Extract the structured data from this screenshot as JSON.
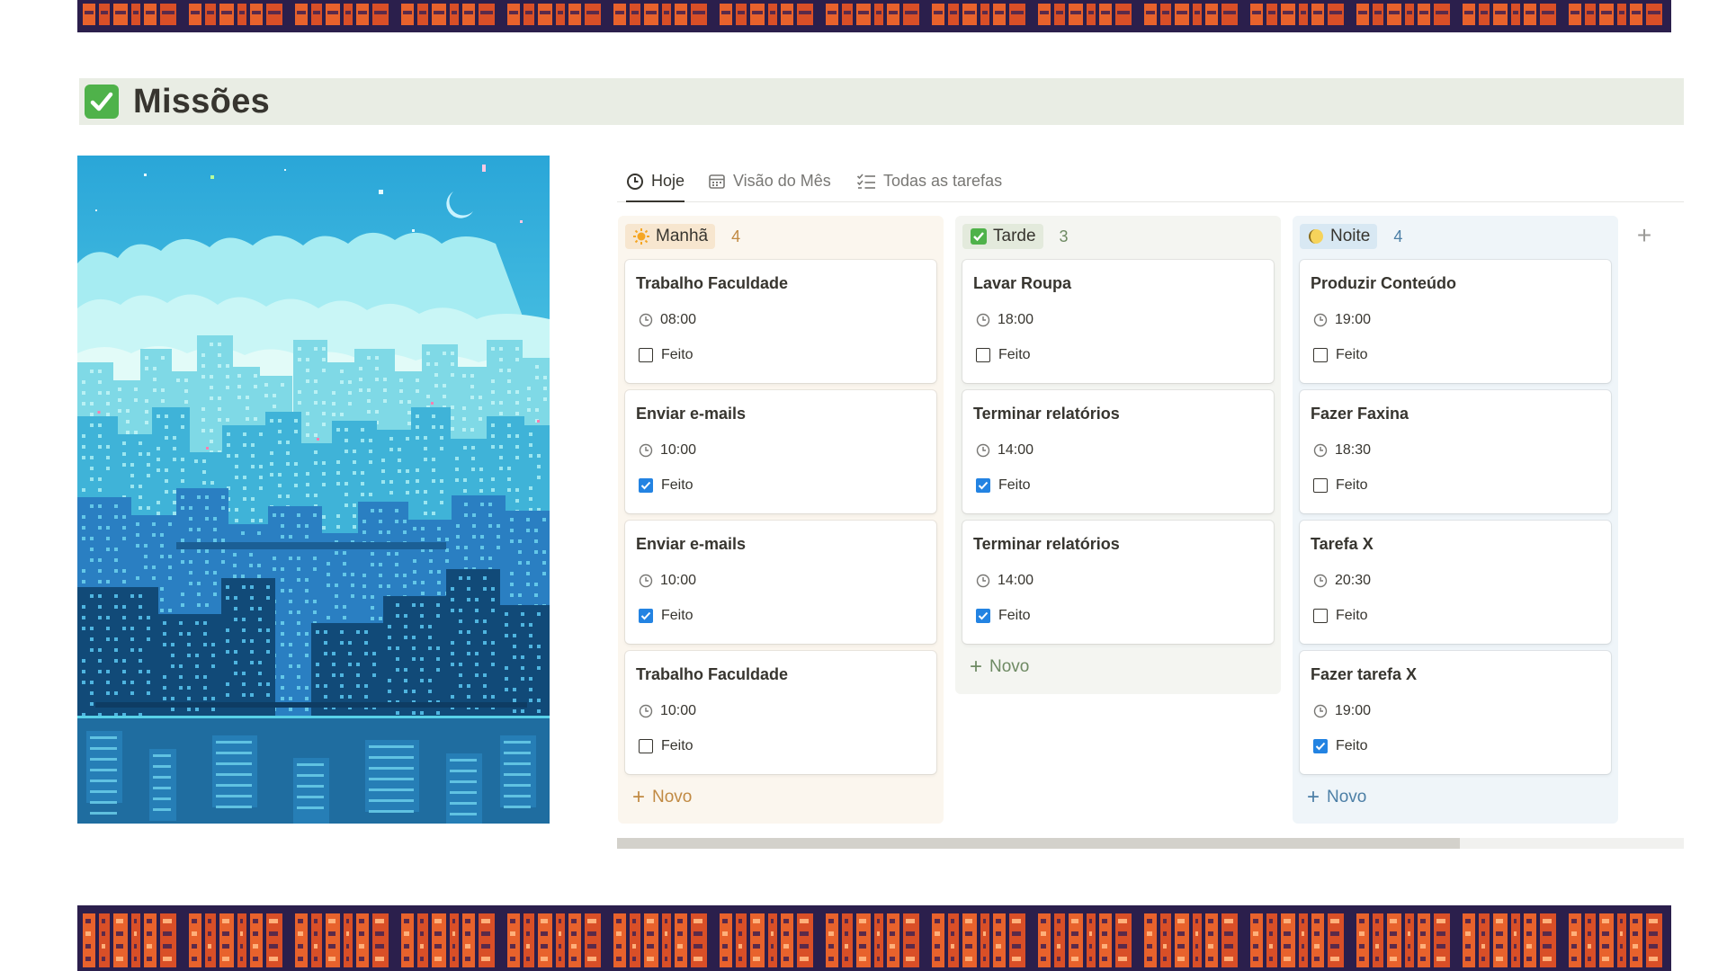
{
  "page": {
    "title": "Missões",
    "title_icon": "check-mark-button-emoji"
  },
  "tabs": [
    {
      "label": "Hoje",
      "icon": "clock-icon",
      "active": true
    },
    {
      "label": "Visão do Mês",
      "icon": "calendar-icon",
      "active": false
    },
    {
      "label": "Todas as tarefas",
      "icon": "checklist-icon",
      "active": false
    }
  ],
  "board": {
    "columns": [
      {
        "name": "Manhã",
        "icon": "sun-icon",
        "count": "4",
        "colors": {
          "bg": "#fbf6ee",
          "pill": "#f7e6cf",
          "count": "#c18a43",
          "novo": "#c18a43"
        },
        "cards": [
          {
            "title": "Trabalho Faculdade",
            "time": "08:00",
            "done_label": "Feito",
            "done": false
          },
          {
            "title": "Enviar e-mails",
            "time": "10:00",
            "done_label": "Feito",
            "done": true
          },
          {
            "title": "Enviar e-mails",
            "time": "10:00",
            "done_label": "Feito",
            "done": true
          },
          {
            "title": "Trabalho Faculdade",
            "time": "10:00",
            "done_label": "Feito",
            "done": false
          }
        ],
        "new_label": "Novo"
      },
      {
        "name": "Tarde",
        "icon": "check-box-icon",
        "count": "3",
        "colors": {
          "bg": "#f4f5f1",
          "pill": "#e3eadc",
          "count": "#6e8a63",
          "novo": "#6e8a63"
        },
        "cards": [
          {
            "title": "Lavar Roupa",
            "time": "18:00",
            "done_label": "Feito",
            "done": false
          },
          {
            "title": "Terminar relatórios",
            "time": "14:00",
            "done_label": "Feito",
            "done": true
          },
          {
            "title": "Terminar relatórios",
            "time": "14:00",
            "done_label": "Feito",
            "done": true
          }
        ],
        "new_label": "Novo"
      },
      {
        "name": "Noite",
        "icon": "moon-icon",
        "count": "4",
        "colors": {
          "bg": "#eff5f9",
          "pill": "#d8e8f3",
          "count": "#4c7fa6",
          "novo": "#4c7fa6"
        },
        "cards": [
          {
            "title": "Produzir Conteúdo",
            "time": "19:00",
            "done_label": "Feito",
            "done": false
          },
          {
            "title": "Fazer Faxina",
            "time": "18:30",
            "done_label": "Feito",
            "done": false
          },
          {
            "title": "Tarefa X",
            "time": "20:30",
            "done_label": "Feito",
            "done": false
          },
          {
            "title": "Fazer tarefa X",
            "time": "19:00",
            "done_label": "Feito",
            "done": true
          }
        ],
        "new_label": "Novo"
      }
    ],
    "add_column_label": "+"
  },
  "scroll": {
    "position": 0.79
  },
  "colors": {
    "accent": "#2383e2",
    "banner_dark": "#2b1f4c",
    "banner_orange": "#e8622c"
  }
}
